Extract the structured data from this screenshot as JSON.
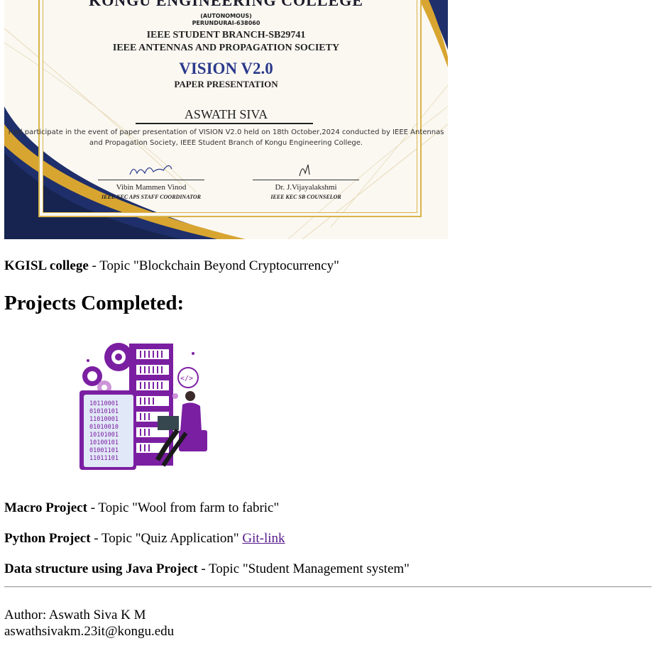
{
  "certificate": {
    "college": "KONGU ENGINEERING COLLEGE",
    "autonomous": "(AUTONOMOUS)",
    "place": "PERUNDURAI-638060",
    "branch": "IEEE STUDENT BRANCH-SB29741",
    "society": "IEEE ANTENNAS AND PROPAGATION SOCIETY",
    "event": "VISION V2.0",
    "event_type": "PAPER  PRESENTATION",
    "recipient": "ASWATH SIVA",
    "description": "Had participate in the event of paper presentation of VISION V2.0 held on 18th October,2024 conducted by IEEE Antennas and Propagation Society, IEEE Student Branch of Kongu Engineering College.",
    "signatories": [
      {
        "name": "Vibin Mammen Vinod",
        "role": "IEEE KEC APS STAFF COORDINATOR"
      },
      {
        "name": "Dr. J.Vijayalakshmi",
        "role": "IEEE KEC SB COUNSELOR"
      }
    ],
    "colors": {
      "navy": "#1e2f6b",
      "gold": "#d8a531",
      "title_blue": "#2b3a8c"
    }
  },
  "presentation": {
    "bold": "KGISL college",
    "rest": " - Topic \"Blockchain Beyond Cryptocurrency\""
  },
  "projects": {
    "heading": "Projects Completed:",
    "illustration_icon": "developer-server-illustration",
    "items": [
      {
        "bold": "Macro Project",
        "rest": " - Topic \"Wool from farm to fabric\""
      },
      {
        "bold": "Python Project",
        "rest": " - Topic \"Quiz Application\" ",
        "link": "Git-link"
      },
      {
        "bold": "Data structure using Java Project",
        "rest": " - Topic \"Student Management system\""
      }
    ]
  },
  "footer": {
    "author": "Author: Aswath Siva K M",
    "email": "aswathsivakm.23it@kongu.edu"
  },
  "colors": {
    "link": "#551a8b",
    "illustration_purple": "#7b1fa2"
  }
}
